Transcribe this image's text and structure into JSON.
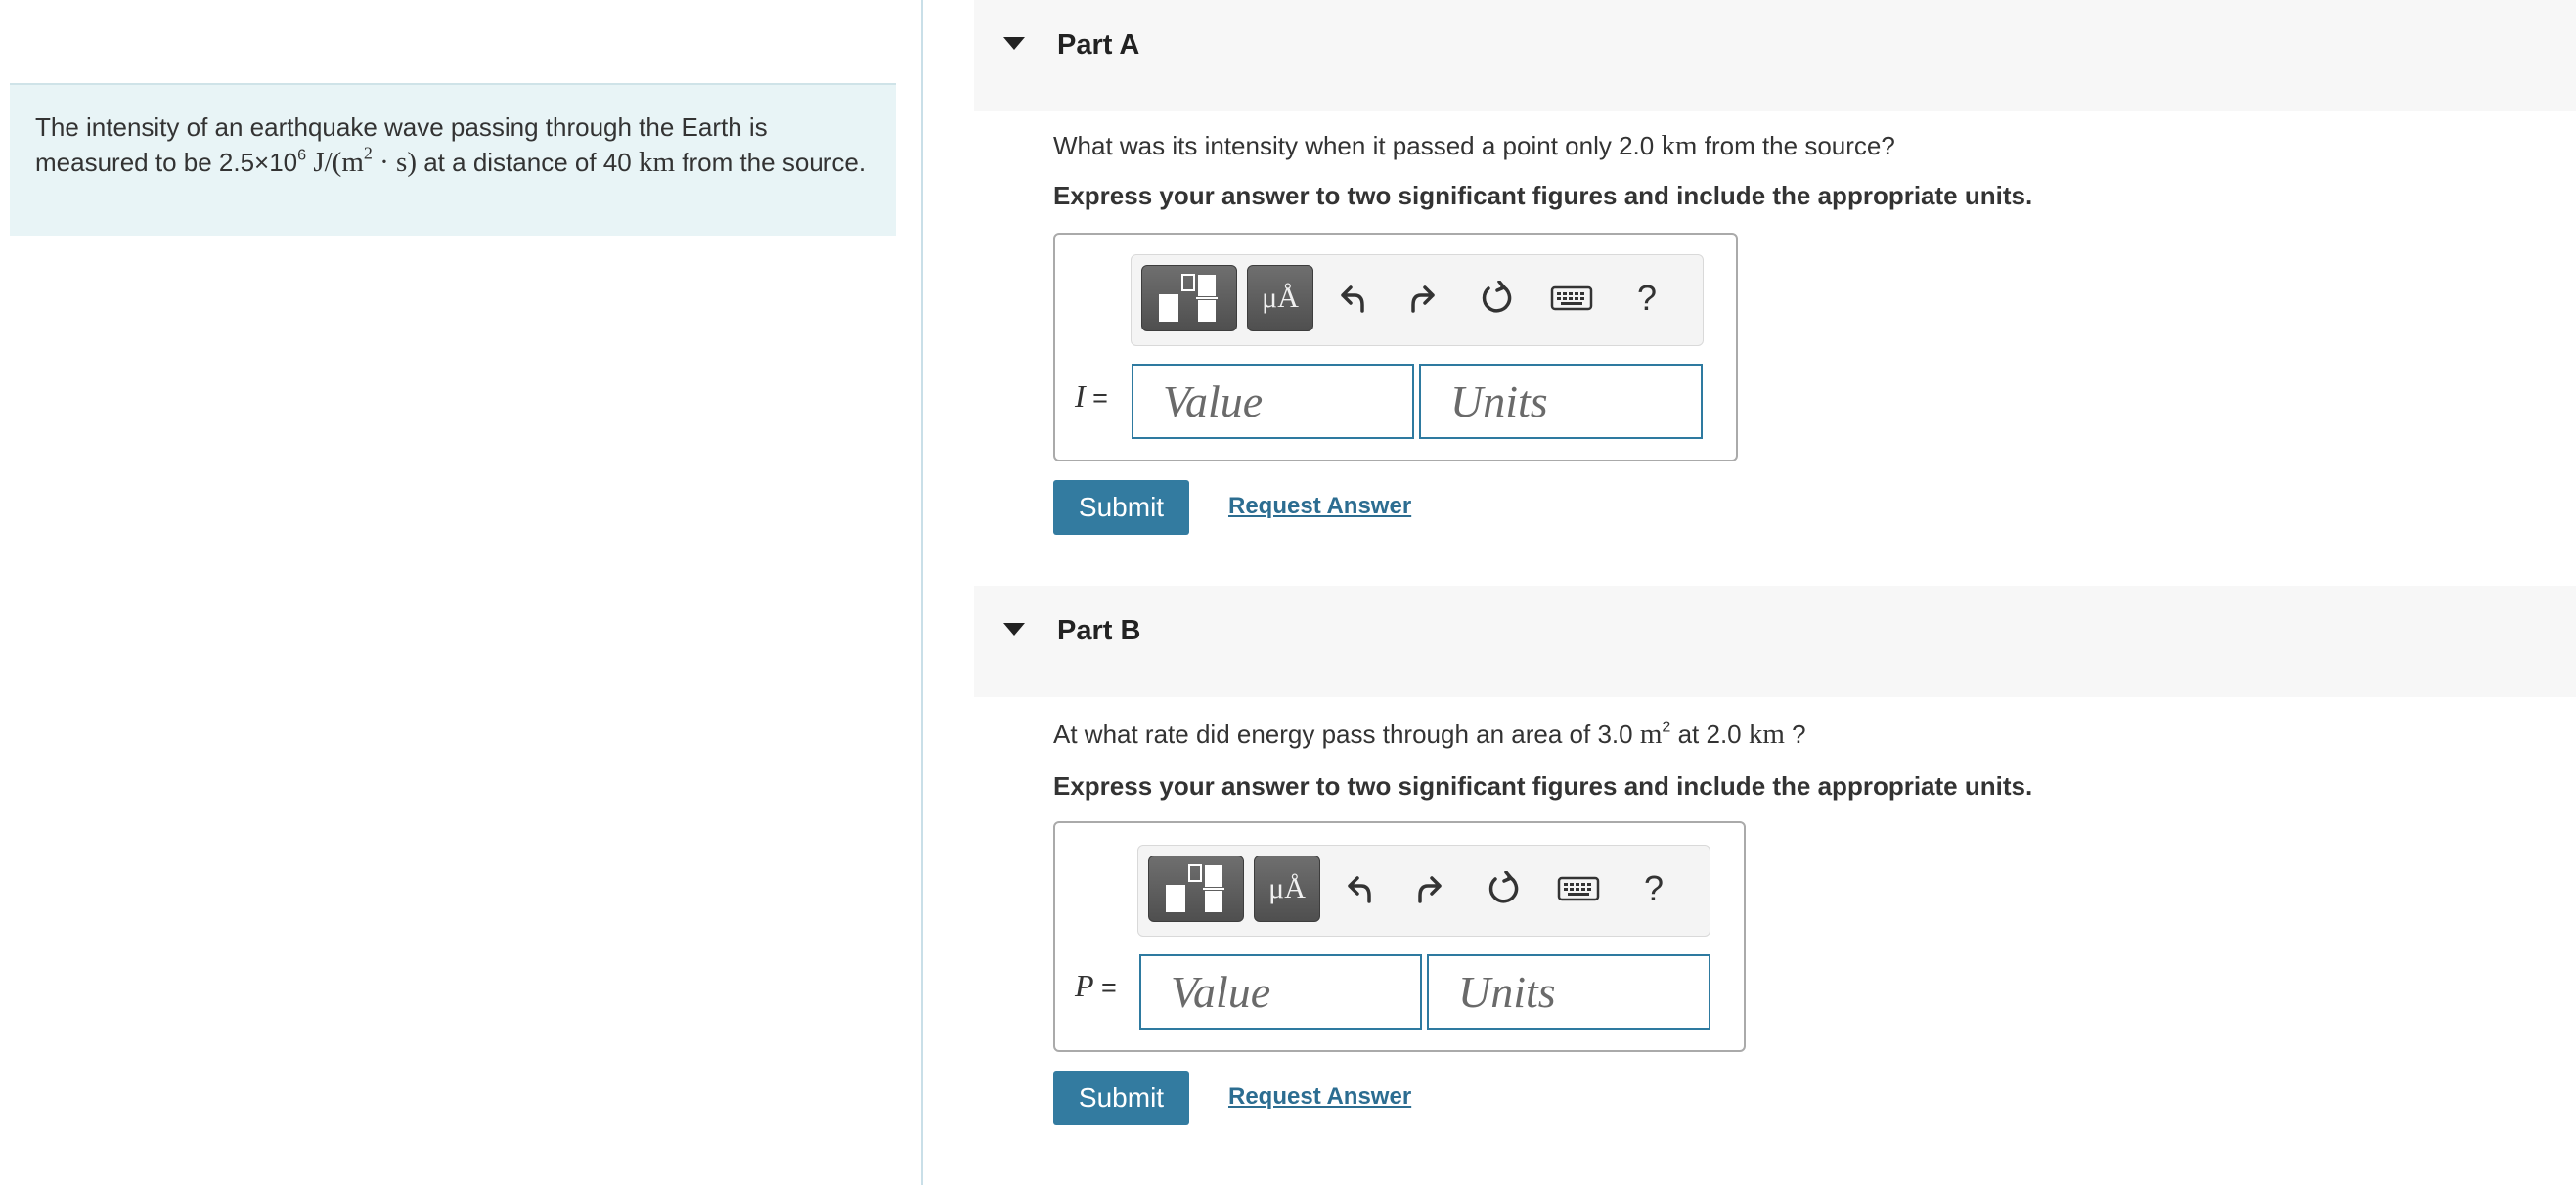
{
  "problem": {
    "text_1": "The intensity of an earthquake wave passing through the Earth is measured to be 2.5×10",
    "exp_1": "6",
    "unit_open": "J/(m",
    "exp_2": "2",
    "unit_close": " · s)",
    "text_2": " at a distance of 40 ",
    "dist_unit": "km",
    "text_3": " from the source."
  },
  "part_a": {
    "title": "Part A",
    "question_pre": "What was its intensity when it passed a point only 2.0 ",
    "question_unit": "km",
    "question_post": " from the source?",
    "instruction": "Express your answer to two significant figures and include the appropriate units.",
    "var_symbol": "I",
    "equals": " =",
    "value_placeholder": "Value",
    "units_placeholder": "Units",
    "submit_label": "Submit",
    "request_label": "Request Answer"
  },
  "part_b": {
    "title": "Part B",
    "question_pre": "At what rate did energy pass through an area of 3.0 ",
    "question_unit": "m",
    "question_exp": "2",
    "question_mid": " at 2.0 ",
    "question_unit2": "km",
    "question_post": " ?",
    "instruction": "Express your answer to two significant figures and include the appropriate units.",
    "var_symbol": "P",
    "equals": " =",
    "value_placeholder": "Value",
    "units_placeholder": "Units",
    "submit_label": "Submit",
    "request_label": "Request Answer"
  },
  "toolbar": {
    "units_button_label": "μÅ",
    "help_label": "?",
    "icons": [
      "templates-icon",
      "units-icon",
      "undo-icon",
      "redo-icon",
      "reset-icon",
      "keyboard-icon",
      "help-icon"
    ]
  },
  "colors": {
    "accent": "#337ba0",
    "link": "#2c6d91",
    "problem_bg": "#e8f4f6",
    "header_bg": "#f7f7f7",
    "input_border": "#2e7aa0"
  }
}
